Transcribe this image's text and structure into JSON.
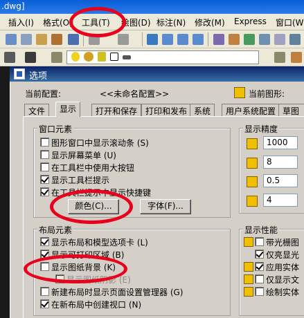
{
  "window": {
    "title": ".dwg]"
  },
  "menu": {
    "insert": "插入(I)",
    "format": "格式(O)",
    "tools": "工具(T)",
    "draw": "绘图(D)",
    "dimension": "标注(N)",
    "modify": "修改(M)",
    "express": "Express",
    "window": "窗口(W"
  },
  "dialog": {
    "title": "选项",
    "current_profile_label": "当前配置:",
    "current_profile_value": "<<未命名配置>>",
    "current_drawing_label": "当前图形:",
    "tabs": [
      "文件",
      "显示",
      "打开和保存",
      "打印和发布",
      "系统",
      "用户系统配置",
      "草图"
    ]
  },
  "window_elements": {
    "title": "窗口元素",
    "items": [
      {
        "label": "图形窗口中显示滚动条 (S)",
        "checked": false
      },
      {
        "label": "显示屏幕菜单 (U)",
        "checked": false
      },
      {
        "label": "在工具栏中使用大按钮",
        "checked": false
      },
      {
        "label": "显示工具栏提示",
        "checked": true
      },
      {
        "label": "在工具栏提示中显示快捷键",
        "checked": true
      }
    ],
    "color_button": "颜色(C)...",
    "font_button": "字体(F)..."
  },
  "layout_elements": {
    "title": "布局元素",
    "items": [
      {
        "label": "显示布局和模型选项卡 (L)",
        "checked": true
      },
      {
        "label": "显示可打印区域 (B)",
        "checked": true
      },
      {
        "label": "显示图纸背景 (K)",
        "checked": false
      },
      {
        "label": "显示图纸阴影 (E)",
        "checked": false
      },
      {
        "label": "新建布局时显示页面设置管理器 (G)",
        "checked": false
      },
      {
        "label": "在新布局中创建视口 (N)",
        "checked": true
      }
    ]
  },
  "display_resolution": {
    "title": "显示精度",
    "values": [
      "1000",
      "8",
      "0.5",
      "4"
    ]
  },
  "display_performance": {
    "title": "显示性能",
    "items": [
      {
        "label": "带光栅图",
        "checked": false
      },
      {
        "label": "仅亮显光",
        "checked": true
      },
      {
        "label": "应用实体",
        "checked": true
      },
      {
        "label": "仅显示文",
        "checked": false
      },
      {
        "label": "绘制实体",
        "checked": false
      }
    ]
  },
  "colors": {
    "accent_title": "#0a246a",
    "annotation": "#e8001c"
  }
}
